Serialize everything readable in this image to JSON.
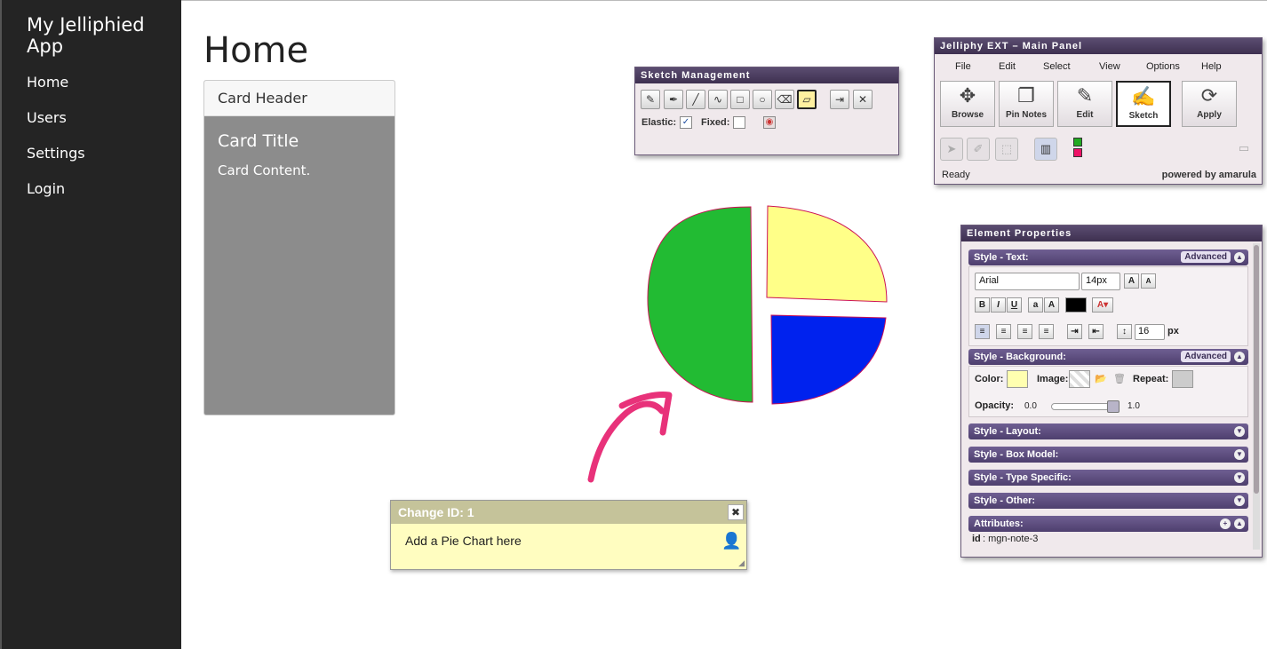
{
  "app": {
    "title": "My Jelliphied App",
    "nav": [
      "Home",
      "Users",
      "Settings",
      "Login"
    ]
  },
  "page": {
    "title": "Home"
  },
  "card": {
    "header": "Card Header",
    "title": "Card Title",
    "content": "Card Content."
  },
  "sketch_panel": {
    "title": "Sketch Management",
    "elastic_label": "Elastic:",
    "elastic_checked": true,
    "fixed_label": "Fixed:",
    "fixed_checked": false,
    "tools": [
      "pencil-icon",
      "marker-icon",
      "line-icon",
      "curve-icon",
      "rectangle-icon",
      "ellipse-icon",
      "eraser-icon",
      "note-shape-icon",
      "export-icon",
      "clear-icon"
    ]
  },
  "main_panel": {
    "title": "Jelliphy EXT –  Main Panel",
    "menu": [
      "File",
      "Edit",
      "Select",
      "View",
      "Options",
      "Help"
    ],
    "buttons": [
      "Browse",
      "Pin Notes",
      "Edit",
      "Sketch",
      "Apply"
    ],
    "active_button": "Sketch",
    "status": "Ready",
    "powered_by": "powered by amarula"
  },
  "props_panel": {
    "title": "Element Properties",
    "text_section": "Style - Text:",
    "advanced_label": "Advanced",
    "font_family": "Arial",
    "font_size": "14px",
    "line_height": "16",
    "line_height_unit": "px",
    "bg_section": "Style - Background:",
    "color_label": "Color:",
    "bg_color": "#ffffb0",
    "image_label": "Image:",
    "repeat_label": "Repeat:",
    "opacity_label": "Opacity:",
    "opacity_min": "0.0",
    "opacity_max": "1.0",
    "opacity_value": 1.0,
    "sections": [
      "Style - Layout:",
      "Style - Box Model:",
      "Style - Type Specific:",
      "Style - Other:"
    ],
    "attributes_label": "Attributes:",
    "attr_key": "id",
    "attr_value": ": mgn-note-3"
  },
  "note": {
    "header": "Change ID:  1",
    "text": "Add a Pie Chart here"
  },
  "sketch": {
    "colors": {
      "green": "#22bb33",
      "yellow": "#ffff88",
      "blue": "#0022ee",
      "outline": "#cc1155",
      "arrow": "#e8327a"
    }
  }
}
